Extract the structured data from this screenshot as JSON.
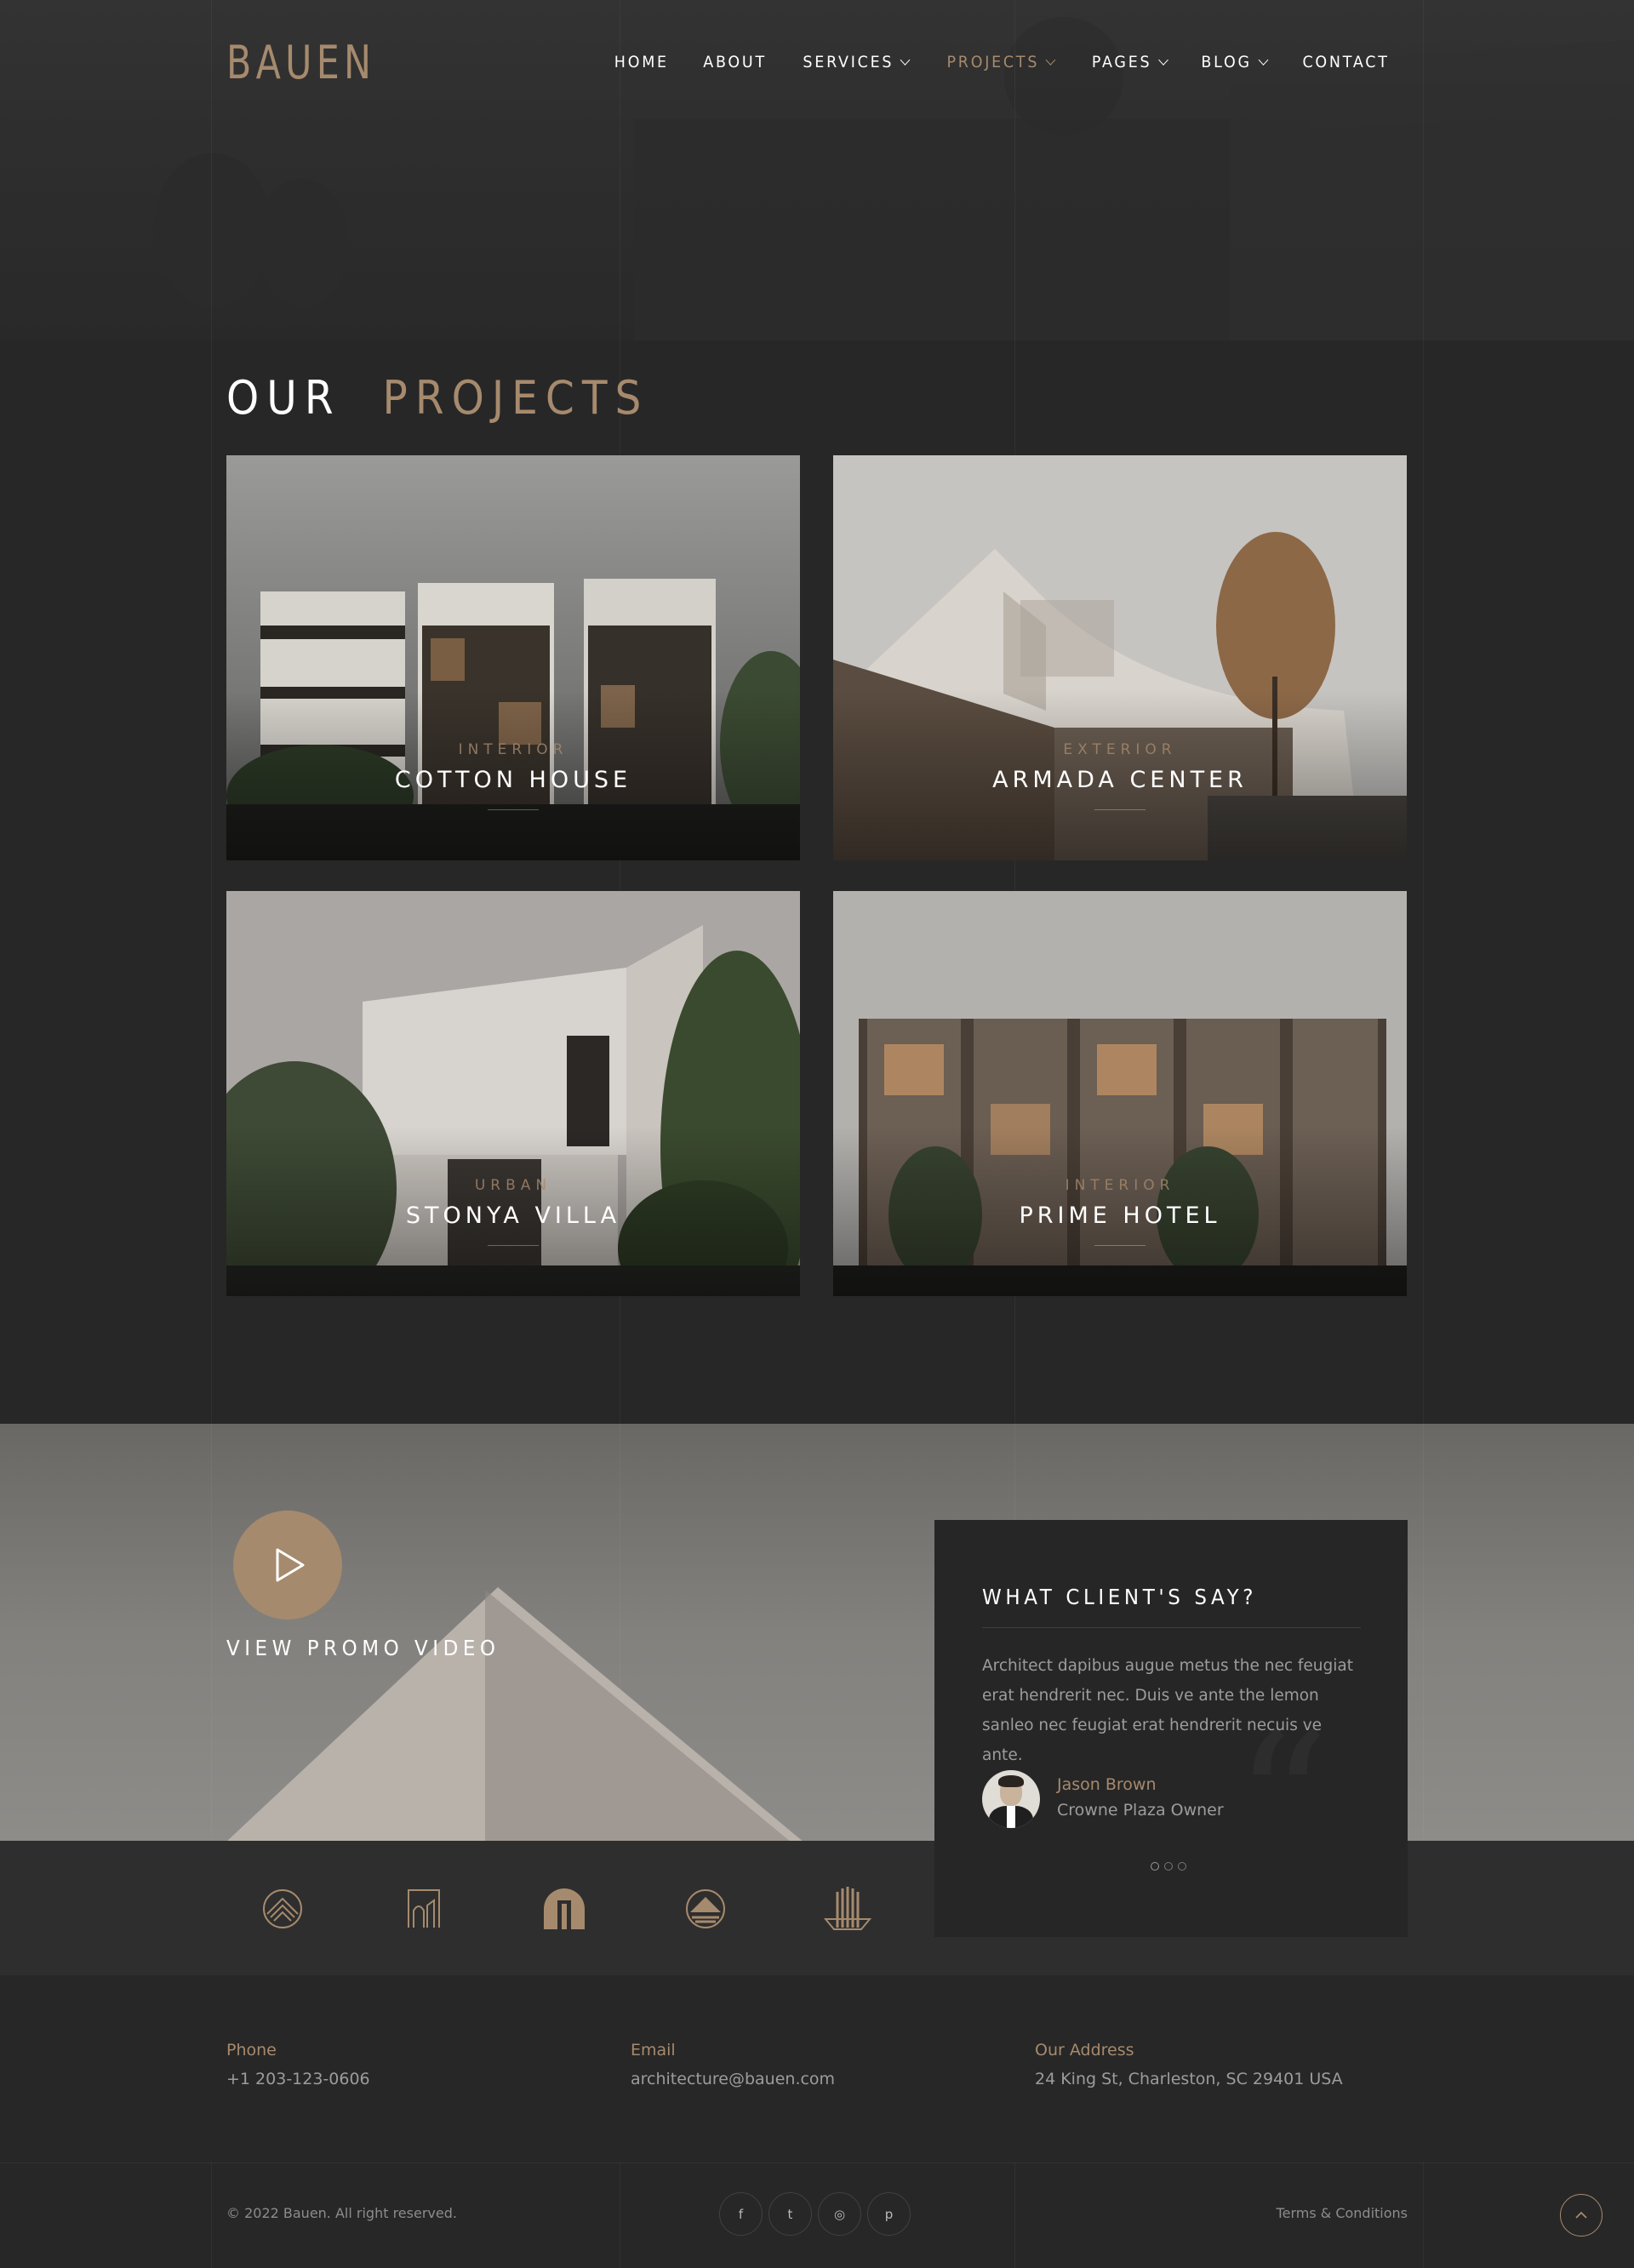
{
  "brand": {
    "logo": "BAUEN",
    "accent_color": "#a68a6d"
  },
  "nav": {
    "items": [
      {
        "label": "HOME",
        "dropdown": false,
        "active": false
      },
      {
        "label": "ABOUT",
        "dropdown": false,
        "active": false
      },
      {
        "label": "SERVICES",
        "dropdown": true,
        "active": false
      },
      {
        "label": "PROJECTS",
        "dropdown": true,
        "active": true
      },
      {
        "label": "PAGES",
        "dropdown": true,
        "active": false
      },
      {
        "label": "BLOG",
        "dropdown": true,
        "active": false
      },
      {
        "label": "CONTACT",
        "dropdown": false,
        "active": false
      }
    ]
  },
  "projects": {
    "title_part1": "OUR",
    "title_part2": "PROJECTS",
    "items": [
      {
        "category": "INTERIOR",
        "name": "COTTON HOUSE"
      },
      {
        "category": "EXTERIOR",
        "name": "ARMADA CENTER"
      },
      {
        "category": "URBAN",
        "name": "STONYA VILLA"
      },
      {
        "category": "INTERIOR",
        "name": "PRIME HOTEL"
      }
    ]
  },
  "promo": {
    "label": "VIEW PROMO VIDEO",
    "icon": "play-icon"
  },
  "testimonial": {
    "title": "WHAT CLIENT'S SAY?",
    "text": "Architect dapibus augue metus the nec feugiat erat hendrerit nec.  Duis ve ante the lemon sanleo nec feugiat erat hendrerit necuis ve ante.",
    "name": "Jason  Brown",
    "role": "Crowne  Plaza Owner",
    "slides": 3,
    "active_slide": 1
  },
  "brand_logos": [
    "pyramid-circle-logo-icon",
    "city-arch-logo-icon",
    "arch-dome-logo-icon",
    "pyramid-circle-logo-icon",
    "columns-logo-icon"
  ],
  "contact": {
    "phone_label": "Phone",
    "phone": "+1 203-123-0606",
    "email_label": "Email",
    "email": "architecture@bauen.com",
    "address_label": "Our Address",
    "address": "24  King St, Charleston, SC 29401 USA"
  },
  "footer": {
    "copyright": "© 2022  Bauen. All right reserved.",
    "socials": [
      {
        "name": "facebook-icon",
        "glyph": "f"
      },
      {
        "name": "twitter-icon",
        "glyph": "t"
      },
      {
        "name": "instagram-icon",
        "glyph": "◎"
      },
      {
        "name": "pinterest-icon",
        "glyph": "p"
      }
    ],
    "terms": "Terms & Conditions"
  }
}
